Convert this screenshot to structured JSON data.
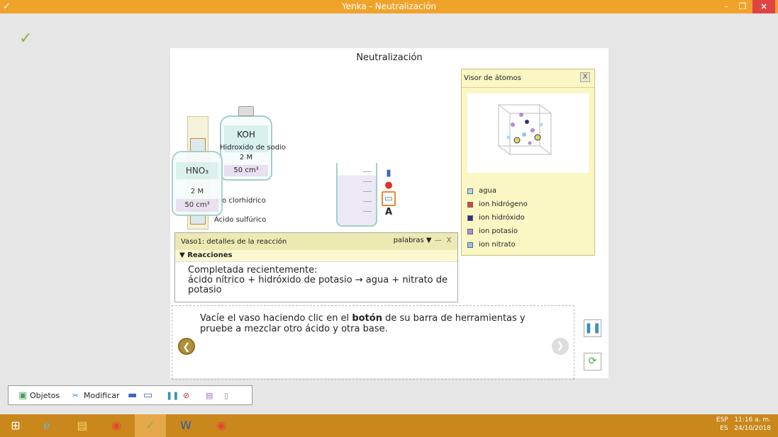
{
  "window": {
    "title": "Yenka - Neutralización",
    "min": "–",
    "max": "❐",
    "close": "×",
    "icon": "✓"
  },
  "app_logo": "✓",
  "stage": {
    "title": "Neutralización",
    "bottles": {
      "koh": {
        "formula": "KOH",
        "name": "Hidroxido de sodio",
        "conc": "2 M",
        "vol": "50 cm³"
      },
      "hno3": {
        "formula": "HNO₃",
        "conc": "2 M",
        "vol": "50 cm³"
      }
    },
    "acids": [
      "ido clorhídrico",
      "Ácido sulfúrico"
    ],
    "tools_text_icon": "A"
  },
  "atom_viewer": {
    "title": "Visor de átomos",
    "close": "X",
    "legend": [
      {
        "label": "agua",
        "color": "#a9d8f0"
      },
      {
        "label": "ion hidrógeno",
        "color": "#e4452e"
      },
      {
        "label": "ion hidróxido",
        "color": "#2f2f8a"
      },
      {
        "label": "ion potasio",
        "color": "#b58bd8"
      },
      {
        "label": "ion nitrato",
        "color": "#8fc6e8"
      }
    ]
  },
  "reaction_panel": {
    "title": "Vaso1: detalles de la reacción",
    "mode": "palabras ▼",
    "min": "—",
    "close": "X",
    "section": "Reacciones",
    "line1": "Completada recientemente:",
    "line2": "ácido nítrico + hidróxido de potasio → agua + nitrato de potasio"
  },
  "instructions": {
    "pre": "Vacíe el vaso haciendo clic en el ",
    "bold": "botón",
    "post": " de su barra de herramientas y pruebe a mezclar otro ácido y otra base.",
    "back": "❮",
    "fwd": "❯"
  },
  "side_buttons": {
    "pause": "❚❚",
    "refresh": "⟳"
  },
  "toolbar": {
    "objetos": "Objetos",
    "modificar": "Modificar"
  },
  "taskbar": {
    "lang1": "ESP",
    "lang2": "ES",
    "time": "11:16 a. m.",
    "date": "24/10/2018"
  }
}
